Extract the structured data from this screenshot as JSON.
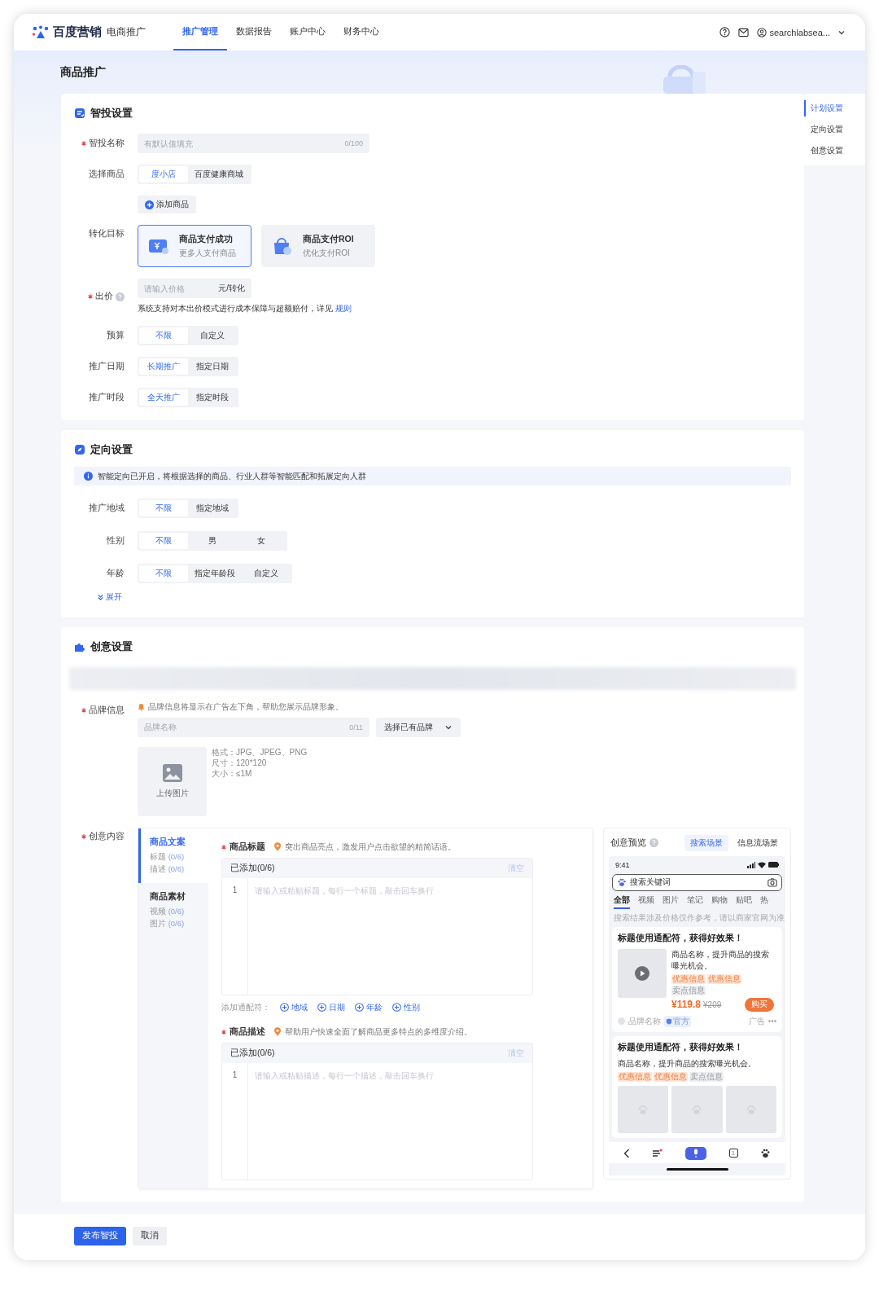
{
  "header": {
    "logo": "百度营销",
    "product": "电商推广",
    "nav": [
      {
        "label": "推广管理",
        "selected": true
      },
      {
        "label": "数据报告",
        "selected": false
      },
      {
        "label": "账户中心",
        "selected": false
      },
      {
        "label": "财务中心",
        "selected": false
      }
    ],
    "account": "searchlabsea..."
  },
  "page_title": "商品推广",
  "anchor_nav": [
    {
      "label": "计划设置",
      "selected": true
    },
    {
      "label": "定向设置",
      "selected": false
    },
    {
      "label": "创意设置",
      "selected": false
    }
  ],
  "sections": [
    {
      "kind": "smart",
      "title": "智投设置",
      "fields": [
        {
          "kind": "input",
          "label": "智投名称",
          "required": true,
          "placeholder": "有默认值填充",
          "counter": "0/100"
        },
        {
          "kind": "segmented",
          "label": "选择商品",
          "required": false,
          "options": [
            {
              "label": "度小店",
              "selected": true
            },
            {
              "label": "百度健康商城",
              "selected": false
            }
          ]
        },
        {
          "kind": "add",
          "button": "添加商品"
        },
        {
          "kind": "goals",
          "label": "转化目标",
          "required": false,
          "options": [
            {
              "title": "商品支付成功",
              "subtitle": "更多人支付商品",
              "selected": true
            },
            {
              "title": "商品支付ROI",
              "subtitle": "优化支付ROI",
              "selected": false
            }
          ]
        },
        {
          "kind": "price",
          "label": "出价",
          "required": true,
          "help": true,
          "placeholder": "请输入价格",
          "unit": "元/转化",
          "note": "系统支持对本出价模式进行成本保障与超额赔付，详见",
          "link": "规则"
        },
        {
          "kind": "segmented",
          "label": "预算",
          "required": false,
          "options": [
            {
              "label": "不限",
              "selected": true
            },
            {
              "label": "自定义",
              "selected": false
            }
          ]
        },
        {
          "kind": "segmented",
          "label": "推广日期",
          "required": false,
          "options": [
            {
              "label": "长期推广",
              "selected": true
            },
            {
              "label": "指定日期",
              "selected": false
            }
          ]
        },
        {
          "kind": "segmented",
          "label": "推广时段",
          "required": false,
          "options": [
            {
              "label": "全天推广",
              "selected": true
            },
            {
              "label": "指定时段",
              "selected": false
            }
          ]
        }
      ]
    },
    {
      "kind": "targeting",
      "title": "定向设置",
      "notice": "智能定向已开启，将根据选择的商品、行业人群等智能匹配和拓展定向人群",
      "fields": [
        {
          "kind": "segmented",
          "label": "推广地域",
          "required": false,
          "options": [
            {
              "label": "不限",
              "selected": true
            },
            {
              "label": "指定地域",
              "selected": false
            }
          ]
        },
        {
          "kind": "segmented",
          "label": "性别",
          "required": false,
          "options": [
            {
              "label": "不限",
              "selected": true
            },
            {
              "label": "男",
              "selected": false
            },
            {
              "label": "女",
              "selected": false
            }
          ]
        },
        {
          "kind": "segmented",
          "label": "年龄",
          "required": false,
          "options": [
            {
              "label": "不限",
              "selected": true
            },
            {
              "label": "指定年龄段",
              "selected": false
            },
            {
              "label": "自定义",
              "selected": false
            }
          ]
        }
      ],
      "expand": "展开"
    },
    {
      "kind": "creative",
      "title": "创意设置",
      "brand": {
        "label": "品牌信息",
        "required": true,
        "hint": "品牌信息将显示在广告左下角，帮助您展示品牌形象。",
        "placeholder": "品牌名称",
        "counter": "0/11",
        "select": "选择已有品牌",
        "upload": "上传图片",
        "specs": [
          "格式：JPG、JPEG、PNG",
          "尺寸：120*120",
          "大小：≤1M"
        ]
      },
      "content": {
        "label": "创意内容",
        "required": true,
        "side_tabs": [
          {
            "title": "商品文案",
            "selected": true,
            "items": [
              {
                "name": "标题",
                "count": "(0/6)"
              },
              {
                "name": "描述",
                "count": "(0/6)"
              }
            ]
          },
          {
            "title": "商品素材",
            "selected": false,
            "items": [
              {
                "name": "视频",
                "count": "(0/6)"
              },
              {
                "name": "图片",
                "count": "(0/6)"
              }
            ]
          }
        ],
        "editors": [
          {
            "label": "商品标题",
            "required": true,
            "hint": "突出商品亮点，激发用户点击欲望的精简话语。",
            "added": "已添加(0/6)",
            "clear": "清空",
            "line": "1",
            "placeholder": "请输入或粘贴标题，每行一个标题，敲击回车换行",
            "wildcards": {
              "label": "添加通配符：",
              "items": [
                "地域",
                "日期",
                "年龄",
                "性别"
              ]
            }
          },
          {
            "label": "商品描述",
            "required": true,
            "hint": "帮助用户快速全面了解商品更多特点的多维度介绍。",
            "added": "已添加(0/6)",
            "clear": "清空",
            "line": "1",
            "placeholder": "请输入或粘贴描述，每行一个描述，敲击回车换行"
          }
        ],
        "preview": {
          "title": "创意预览",
          "tabs": [
            {
              "label": "搜索场景",
              "selected": true
            },
            {
              "label": "信息流场景",
              "selected": false
            }
          ],
          "phone": {
            "time": "9:41",
            "search_placeholder": "搜索关键词",
            "tabs": [
              {
                "label": "全部",
                "selected": true
              },
              {
                "label": "视频",
                "selected": false
              },
              {
                "label": "图片",
                "selected": false
              },
              {
                "label": "笔记",
                "selected": false
              },
              {
                "label": "购物",
                "selected": false
              },
              {
                "label": "贴吧",
                "selected": false
              },
              {
                "label": "热",
                "selected": false
              }
            ],
            "disclaimer": "搜索结果涉及价格仅作参考，请以商家官网为准",
            "cards": [
              {
                "kind": "video",
                "title": "标题使用通配符，获得好效果！",
                "desc": "商品名称，提升商品的搜索曝光机会。",
                "tags": [
                  {
                    "label": "优惠信息",
                    "kind": "promo"
                  },
                  {
                    "label": "优惠信息",
                    "kind": "promo"
                  },
                  {
                    "label": "卖点信息",
                    "kind": "point"
                  }
                ],
                "price": "¥119.8",
                "original_price": "¥209",
                "buy": "购买",
                "brand": "品牌名称",
                "badge": "官方",
                "ad_label": "广告"
              },
              {
                "kind": "gallery",
                "title": "标题使用通配符，获得好效果！",
                "desc": "商品名称，提升商品的搜索曝光机会。",
                "tags": [
                  {
                    "label": "优惠信息",
                    "kind": "promo"
                  },
                  {
                    "label": "优惠信息",
                    "kind": "promo"
                  },
                  {
                    "label": "卖点信息",
                    "kind": "point"
                  }
                ]
              }
            ],
            "tab_count": "1"
          }
        }
      }
    }
  ],
  "footer": {
    "buttons": [
      {
        "label": "发布智投",
        "kind": "primary"
      },
      {
        "label": "取消",
        "kind": "default"
      }
    ]
  }
}
